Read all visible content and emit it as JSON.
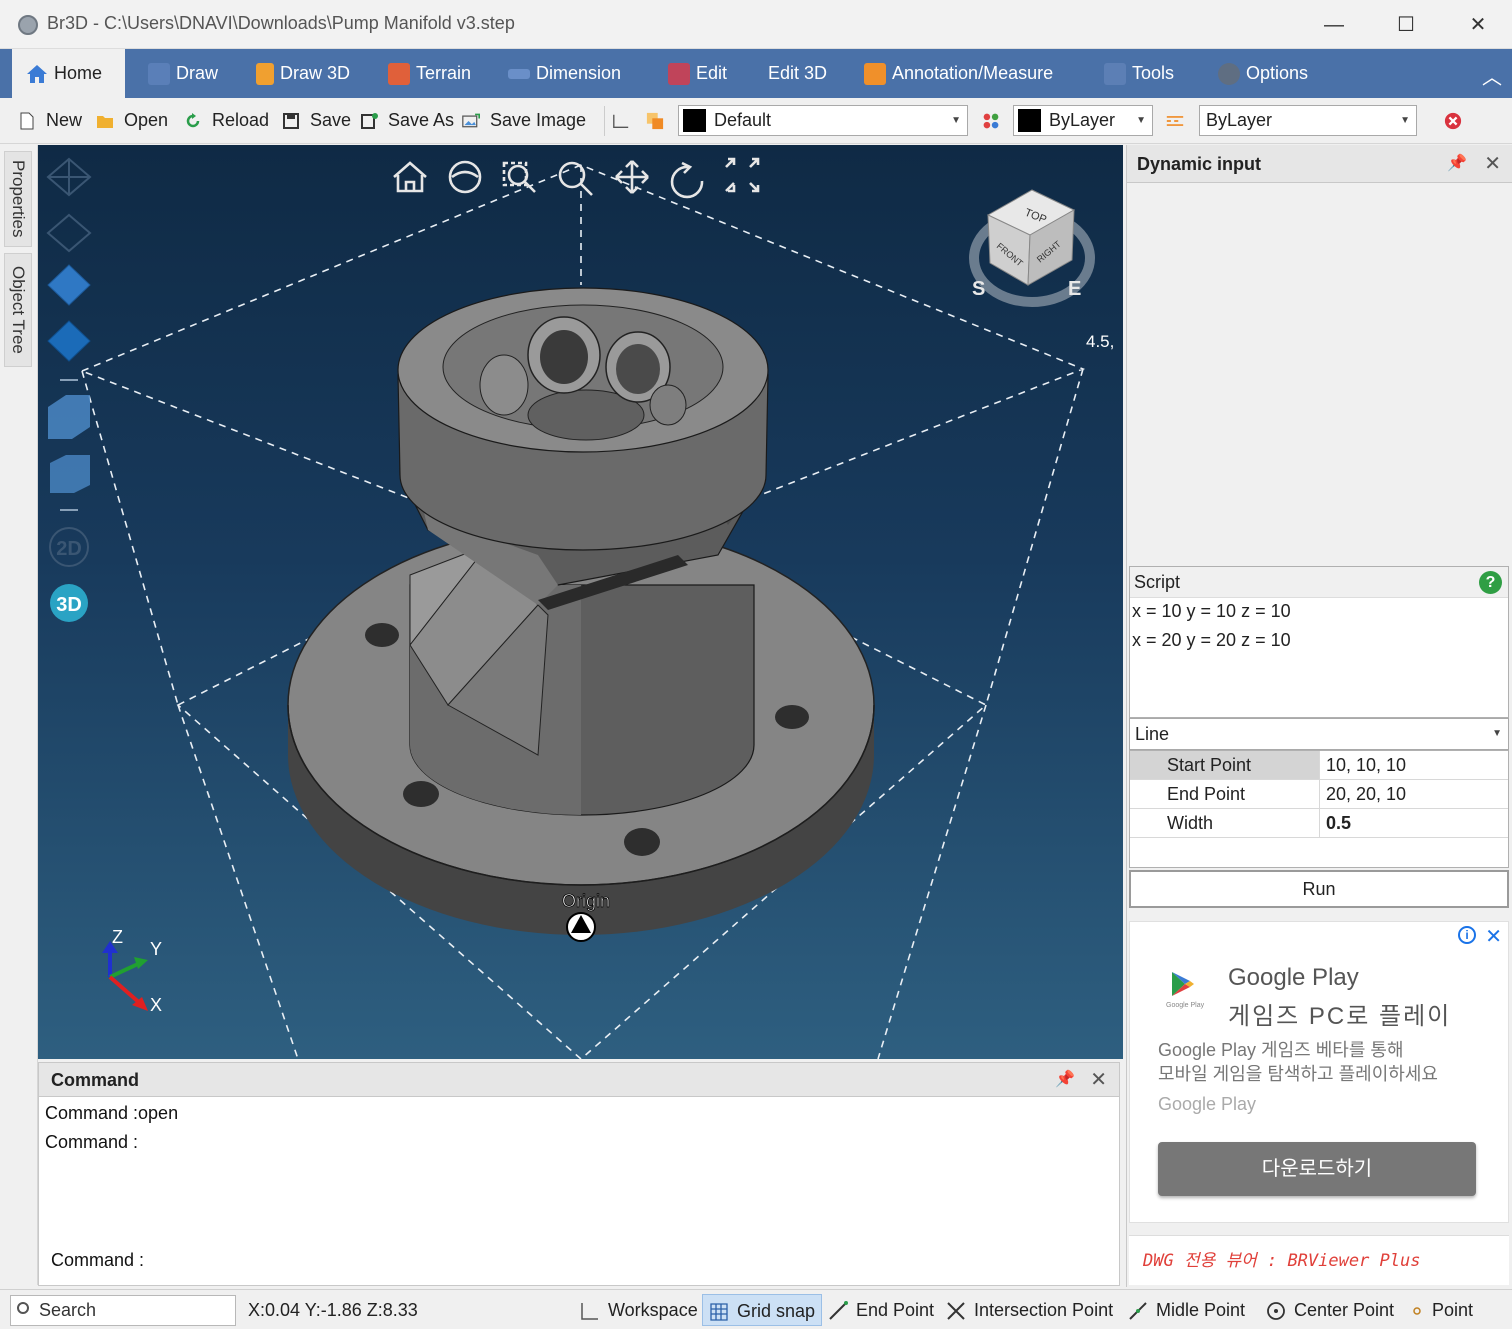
{
  "window": {
    "title": "Br3D - C:\\Users\\DNAVI\\Downloads\\Pump Manifold v3.step",
    "minimize": "—",
    "maximize": "☐",
    "close": "✕"
  },
  "ribbon": {
    "tabs": [
      {
        "label": "Home",
        "icon": "home-icon"
      },
      {
        "label": "Draw",
        "icon": "draw-icon"
      },
      {
        "label": "Draw 3D",
        "icon": "draw3d-icon"
      },
      {
        "label": "Terrain",
        "icon": "terrain-icon"
      },
      {
        "label": "Dimension",
        "icon": "dimension-icon"
      },
      {
        "label": "Edit",
        "icon": "edit-icon"
      },
      {
        "label": "Edit 3D",
        "icon": ""
      },
      {
        "label": "Annotation/Measure",
        "icon": "annotation-icon"
      },
      {
        "label": "Tools",
        "icon": "tools-icon"
      },
      {
        "label": "Options",
        "icon": "options-icon"
      }
    ],
    "collapse": "︿"
  },
  "toolbar": {
    "new": "New",
    "open": "Open",
    "reload": "Reload",
    "save": "Save",
    "save_as": "Save As",
    "save_image": "Save Image",
    "layer": "Default",
    "color": "ByLayer",
    "linetype": "ByLayer"
  },
  "left_tabs": {
    "properties": "Properties",
    "object_tree": "Object Tree"
  },
  "viewport": {
    "origin_label": "Origin",
    "scale_label": "4.5,",
    "view_cube": {
      "top": "TOP",
      "front": "FRONT",
      "right": "RIGHT",
      "compass_s": "S",
      "compass_e": "E"
    },
    "axes": {
      "z": "Z",
      "y": "Y",
      "x": "X"
    },
    "mode_2d": "2D",
    "mode_3d": "3D"
  },
  "command_panel": {
    "title": "Command",
    "lines": [
      "Command :open",
      "Command :"
    ],
    "prompt": "Command :"
  },
  "dynamic_input": {
    "title": "Dynamic input",
    "script": {
      "label": "Script",
      "help": "?",
      "lines": [
        "x = 10 y = 10 z = 10",
        "x = 20 y = 20 z = 10"
      ]
    },
    "entity_type": "Line",
    "properties": [
      {
        "name": "Start Point",
        "value": "10, 10, 10"
      },
      {
        "name": "End Point",
        "value": "20, 20, 10"
      },
      {
        "name": "Width",
        "value": "0.5"
      }
    ],
    "run": "Run"
  },
  "ad": {
    "title": "Google Play",
    "subtitle": "게임즈 PC로 플레이",
    "desc1": "Google Play 게임즈 베타를 통해",
    "desc2": "모바일 게임을 탐색하고 플레이하세요",
    "brand": "Google Play",
    "download": "다운로드하기",
    "icon_caption": "Google Play"
  },
  "brviewer": "DWG 전용 뷰어 : BRViewer Plus",
  "statusbar": {
    "search_placeholder": "Search",
    "coords": "X:0.04 Y:-1.86 Z:8.33",
    "items": [
      {
        "label": "Workspace",
        "active": false
      },
      {
        "label": "Grid snap",
        "active": true
      },
      {
        "label": "End Point",
        "active": false
      },
      {
        "label": "Intersection Point",
        "active": false
      },
      {
        "label": "Midle Point",
        "active": false
      },
      {
        "label": "Center Point",
        "active": false
      },
      {
        "label": "Point",
        "active": false
      }
    ]
  },
  "colors": {
    "ribbon": "#4a71a8",
    "viewport_top": "#0f2a45",
    "viewport_bottom": "#2e5f80"
  }
}
